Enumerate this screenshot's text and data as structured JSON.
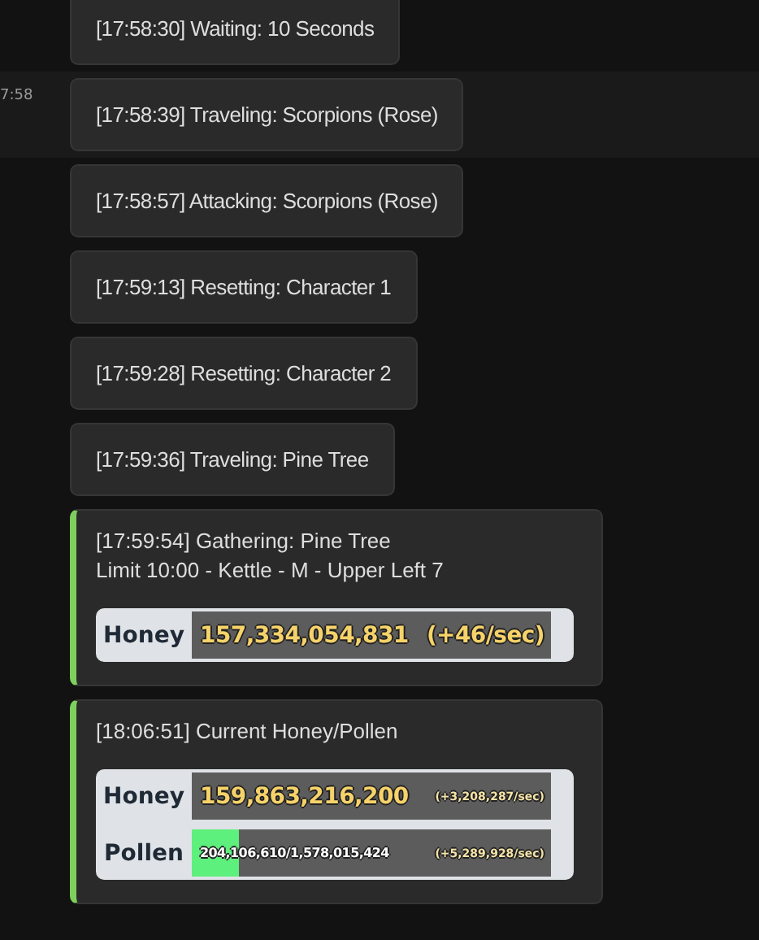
{
  "messages": [
    {
      "kind": "bubble",
      "text": "[17:58:30] Waiting: 10 Seconds",
      "hovered": false
    },
    {
      "kind": "bubble",
      "text": "[17:58:39] Traveling: Scorpions (Rose)",
      "hovered": true,
      "timestamp": "7:58"
    },
    {
      "kind": "bubble",
      "text": "[17:58:57] Attacking: Scorpions (Rose)",
      "hovered": false
    },
    {
      "kind": "bubble",
      "text": "[17:59:13] Resetting: Character 1",
      "hovered": false
    },
    {
      "kind": "bubble",
      "text": "[17:59:28] Resetting: Character 2",
      "hovered": false
    },
    {
      "kind": "bubble",
      "text": "[17:59:36] Traveling: Pine Tree",
      "hovered": false
    },
    {
      "kind": "embed",
      "hovered": false,
      "color": "#7ed05c",
      "lines": [
        "[17:59:54] Gathering: Pine Tree",
        "Limit 10:00 - Kettle - M - Upper Left 7"
      ],
      "stats": [
        {
          "label": "Honey",
          "value": "157,334,054,831",
          "rate": "(+46/sec)"
        }
      ]
    },
    {
      "kind": "embed",
      "hovered": false,
      "color": "#7ed05c",
      "lines": [
        "[18:06:51] Current Honey/Pollen"
      ],
      "stats": [
        {
          "label": "Honey",
          "value": "159,863,216,200",
          "rate": "(+3,208,287/sec)"
        },
        {
          "label": "Pollen",
          "value": "204,106,610/1,578,015,424",
          "rate": "(+5,289,928/sec)",
          "level": 0.13
        }
      ]
    }
  ]
}
